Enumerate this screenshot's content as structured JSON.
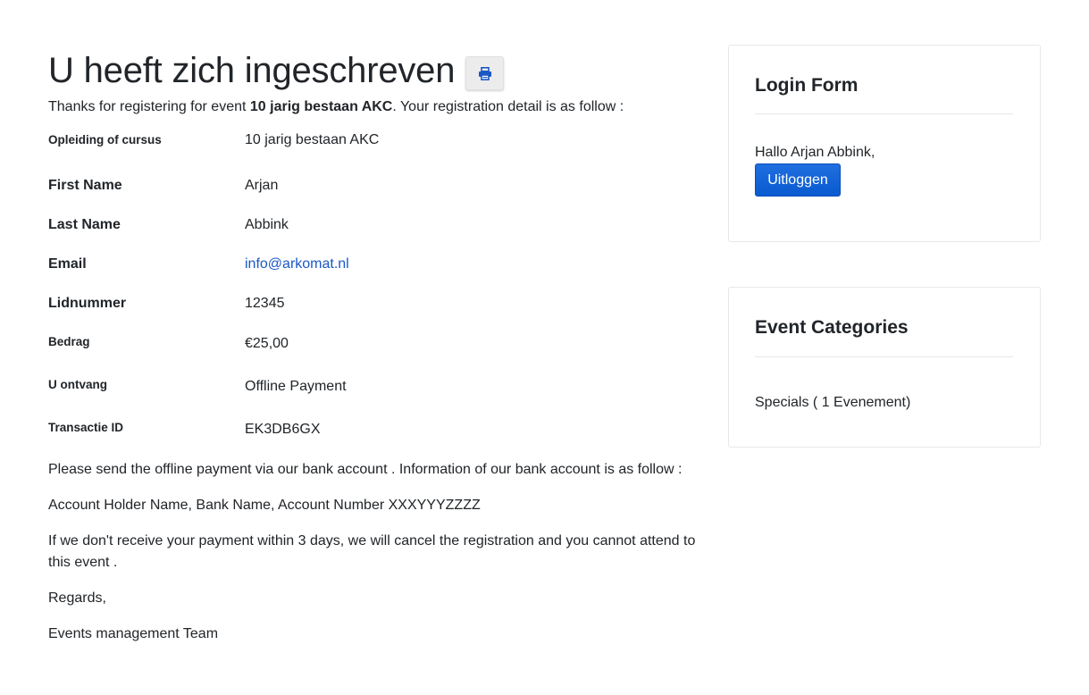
{
  "page": {
    "title": "U heeft zich ingeschreven",
    "intro": {
      "before": "Thanks for registering for event ",
      "event_name": "10 jarig bestaan AKC",
      "after": ". Your registration detail is as follow :"
    },
    "details": [
      {
        "label": "Opleiding of cursus",
        "value": "10 jarig bestaan AKC"
      },
      {
        "label": "First Name",
        "value": "Arjan"
      },
      {
        "label": "Last Name",
        "value": "Abbink"
      },
      {
        "label": "Email",
        "value": "info@arkomat.nl"
      },
      {
        "label": "Lidnummer",
        "value": "12345"
      },
      {
        "label": "Bedrag",
        "value": "€25,00"
      },
      {
        "label": "U ontvang",
        "value": "Offline Payment"
      },
      {
        "label": "Transactie ID",
        "value": "EK3DB6GX"
      }
    ],
    "paragraphs": [
      "Please send the offline payment via our bank account . Information of our bank account is as follow :",
      "Account Holder Name, Bank Name, Account Number XXXYYYZZZZ",
      "If we don't receive your payment within 3 days, we will cancel the registration and you cannot attend to this event .",
      "Regards,",
      "Events management Team"
    ]
  },
  "login_card": {
    "title": "Login Form",
    "greeting": "Hallo Arjan Abbink,",
    "logout_label": "Uitloggen"
  },
  "categories_card": {
    "title": "Event Categories",
    "items": [
      {
        "label": "Specials ( 1 Evenement)"
      }
    ]
  },
  "colors": {
    "accent": "#0a5ad0",
    "link": "#1b58c4",
    "text": "#212529"
  },
  "icons": {
    "print": "print-icon"
  }
}
